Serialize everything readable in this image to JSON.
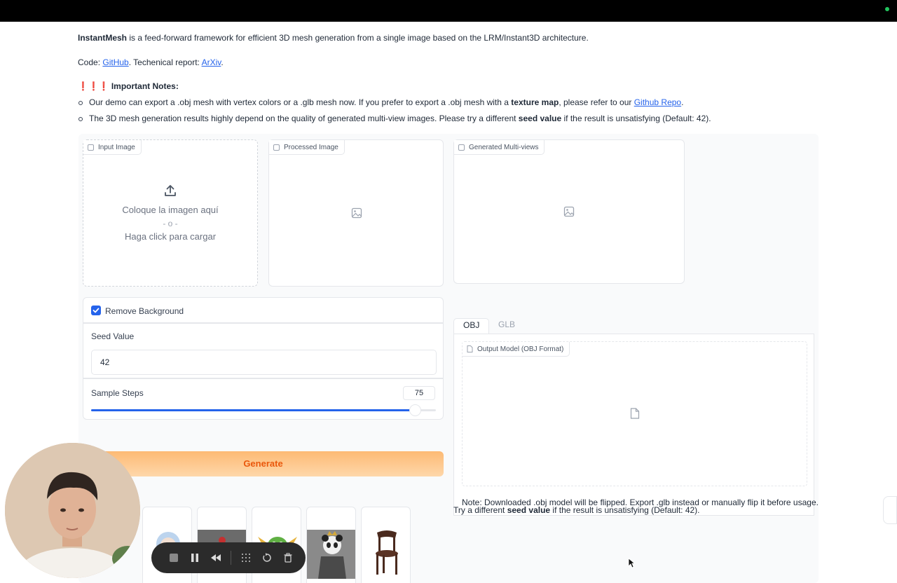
{
  "intro": {
    "app_name": "InstantMesh",
    "description": " is a feed-forward framework for efficient 3D mesh generation from a single image based on the LRM/Instant3D architecture.",
    "code_prefix": "Code: ",
    "github_link": "GitHub",
    "report_prefix": ". Techenical report: ",
    "arxiv_link": "ArXiv",
    "period": "."
  },
  "notes": {
    "marks": "❗❗❗",
    "title": "Important Notes:",
    "bullet1_pre": "Our demo can export a .obj mesh with vertex colors or a .glb mesh now. If you prefer to export a .obj mesh with a ",
    "bullet1_bold": "texture map",
    "bullet1_mid": ", please refer to our ",
    "bullet1_link": "Github Repo",
    "bullet1_end": ".",
    "bullet2_pre": "The 3D mesh generation results highly depend on the quality of generated multi-view images. Please try a different ",
    "bullet2_bold": "seed value",
    "bullet2_end": " if the result is unsatisfying (Default: 42)."
  },
  "panels": {
    "input_label": "Input Image",
    "drop_text": "Coloque la imagen aquí",
    "or_text": "- o -",
    "click_text": "Haga click para cargar",
    "processed_label": "Processed Image",
    "multiview_label": "Generated Multi-views"
  },
  "options": {
    "remove_bg_label": "Remove Background",
    "remove_bg_checked": true,
    "seed_label": "Seed Value",
    "seed_value": "42",
    "steps_label": "Sample Steps",
    "steps_value": "75",
    "steps_fraction": 0.94,
    "generate_label": "Generate"
  },
  "output": {
    "tabs": [
      "OBJ",
      "GLB"
    ],
    "active_tab": "OBJ",
    "output_label": "Output Model (OBJ Format)",
    "note": "Note: Downloaded .obj model will be flipped. Export .glb instead or manually flip it before usage.",
    "seed_note_pre": "Try a different ",
    "seed_note_bold": "seed value",
    "seed_note_end": " if the result is unsatisfying (Default: 42)."
  },
  "examples": [
    "hatsune-figure",
    "cake",
    "dragon",
    "panda-king",
    "chair"
  ],
  "recorder_toolbar": [
    "stop",
    "pause",
    "rewind",
    "grid",
    "restart",
    "delete"
  ],
  "colors": {
    "accent": "#2563eb",
    "generate_bg": "#fdba74",
    "generate_text": "#ea580c"
  }
}
